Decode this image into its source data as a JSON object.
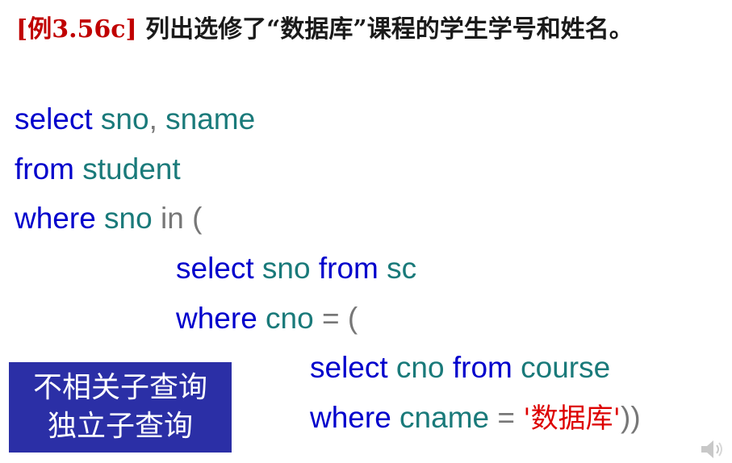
{
  "title": {
    "tag": "[例3.56c]",
    "text": " 列出选修了“数据库”课程的学生学号和姓名。"
  },
  "code": {
    "line1": {
      "kw1": "select",
      "id1": " sno",
      "op1": ",",
      "id2": " sname"
    },
    "line2": {
      "kw1": "from",
      "id1": " student"
    },
    "line3": {
      "kw1": "where",
      "id1": " sno",
      "op1": " in ("
    },
    "line4": {
      "kw1": "select",
      "id1": " sno",
      "kw2": " from",
      "id2": " sc"
    },
    "line5": {
      "kw1": "where",
      "id1": " cno",
      "op1": " = ("
    },
    "line6": {
      "kw1": "select",
      "id1": " cno",
      "kw2": " from",
      "id2": " course"
    },
    "line7": {
      "kw1": "where",
      "id1": " cname",
      "op1": " = ",
      "str1": "'数据库'",
      "op2": "))"
    }
  },
  "badge": {
    "line1": "不相关子查询",
    "line2": "独立子查询",
    "color": "#2b2fa6"
  },
  "icons": {
    "corner": "speaker-icon"
  }
}
